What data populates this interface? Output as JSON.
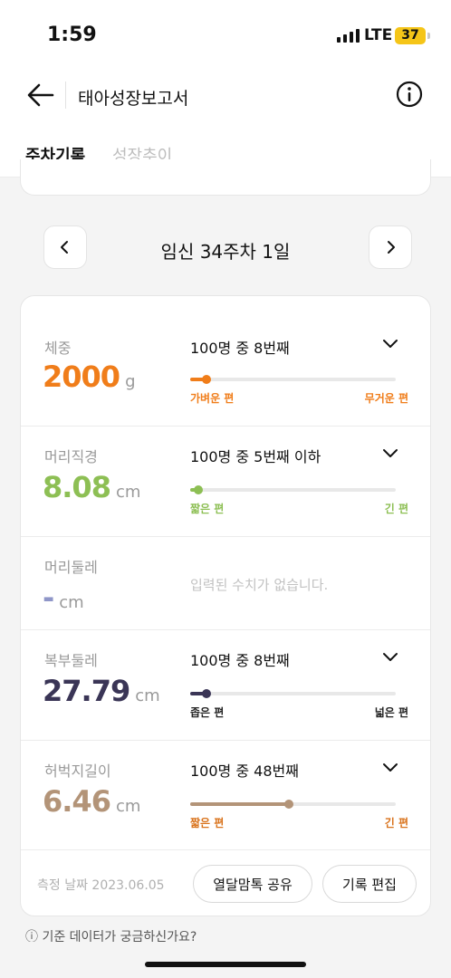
{
  "status_bar": {
    "time": "1:59",
    "network": "LTE",
    "battery": "37"
  },
  "header": {
    "title": "태아성장보고서",
    "back_icon": "arrow-left-icon",
    "info_icon": "info-circle-icon"
  },
  "tabs": [
    {
      "label": "주차기록",
      "active": true
    },
    {
      "label": "성장추이",
      "active": false
    }
  ],
  "week": {
    "label": "임신 34주차 1일"
  },
  "measurements": [
    {
      "label": "체중",
      "value": "2000",
      "unit": "g",
      "rank": "100명 중 8번째",
      "position_fraction": 0.08,
      "low_label": "가벼운 편",
      "high_label": "무거운 편",
      "color": "#f07d1a"
    },
    {
      "label": "머리직경",
      "value": "8.08",
      "unit": "cm",
      "rank": "100명 중 5번째 이하",
      "position_fraction": 0.04,
      "low_label": "짧은 편",
      "high_label": "긴 편",
      "color": "#8dbf54"
    },
    {
      "label": "머리둘레",
      "value": "-",
      "unit": "cm",
      "empty_text": "입력된 수치가 없습니다.",
      "color": "#8f96c8"
    },
    {
      "label": "복부둘레",
      "value": "27.79",
      "unit": "cm",
      "rank": "100명 중 8번째",
      "position_fraction": 0.08,
      "low_label": "좁은 편",
      "high_label": "넓은 편",
      "color": "#3a3556"
    },
    {
      "label": "허벅지길이",
      "value": "6.46",
      "unit": "cm",
      "rank": "100명 중 48번째",
      "position_fraction": 0.48,
      "low_label": "짧은 편",
      "high_label": "긴 편",
      "color": "#b39478"
    }
  ],
  "footer": {
    "date": "측정 날짜 2023.06.05",
    "share_label": "열달맘톡 공유",
    "edit_label": "기록 편집"
  },
  "bottom_hint": "ⓘ 기준 데이터가 궁금하신가요?"
}
